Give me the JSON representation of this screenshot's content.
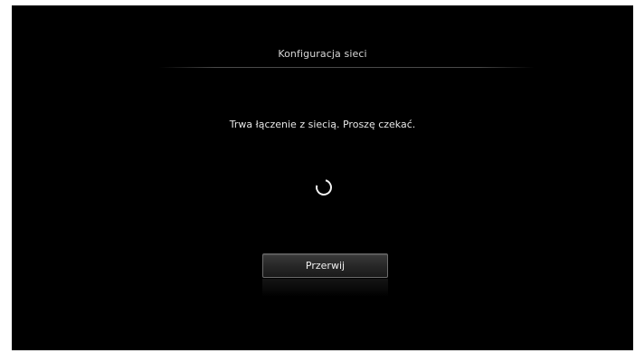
{
  "dialog": {
    "title": "Konfiguracja sieci",
    "message": "Trwa łączenie z siecią. Proszę czekać.",
    "cancel_label": "Przerwij"
  },
  "icons": {
    "spinner": "loading-spinner-icon"
  },
  "colors": {
    "background": "#000000",
    "text": "#e6e6e6",
    "button_border": "#6b6b6b"
  }
}
